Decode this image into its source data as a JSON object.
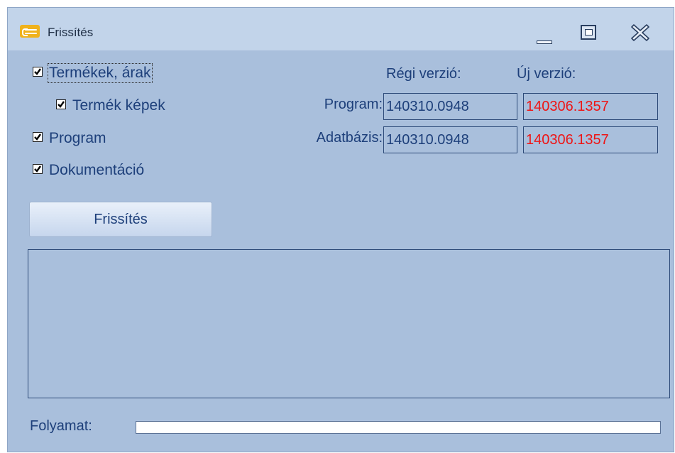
{
  "window": {
    "title": "Frissítés"
  },
  "options": {
    "products_prices": {
      "label": "Termékek, árak",
      "checked": true
    },
    "product_images": {
      "label": "Termék képek",
      "checked": true
    },
    "program": {
      "label": "Program",
      "checked": true
    },
    "documentation": {
      "label": "Dokumentáció",
      "checked": true
    }
  },
  "versions": {
    "old_header": "Régi verzió:",
    "new_header": "Új verzió:",
    "rows": [
      {
        "label": "Program:",
        "old": "140310.0948",
        "new": "140306.1357"
      },
      {
        "label": "Adatbázis:",
        "old": "140310.0948",
        "new": "140306.1357"
      }
    ]
  },
  "update_button": {
    "label": "Frissítés"
  },
  "progress": {
    "label": "Folyamat:",
    "value": 0
  },
  "colors": {
    "window_bg": "#a9bfdc",
    "text": "#1d3f7a",
    "new_version_text": "#ee1515",
    "icon_accent": "#f0b21c"
  },
  "icons": {
    "app": "app-logo-icon",
    "minimize": "minimize-icon",
    "maximize": "maximize-icon",
    "close": "close-icon",
    "checkbox": "checkmark-icon"
  }
}
